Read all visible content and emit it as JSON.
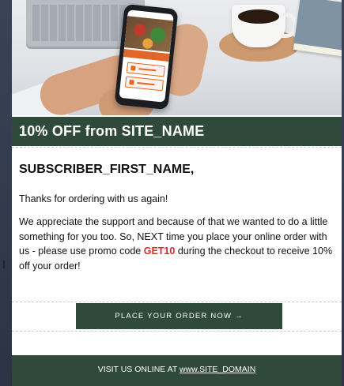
{
  "title_band": {
    "title": "10% OFF from SITE_NAME"
  },
  "body": {
    "greeting": "SUBSCRIBER_FIRST_NAME,",
    "thanks": "Thanks for ordering with us again!",
    "message_before_code": "We appreciate the support and because of that we wanted to do a little something for you too. So, NEXT time you place your online order with us - please use promo code ",
    "promo_code": "GET10",
    "message_after_code": " during the checkout to receive 10% off your order!"
  },
  "cta": {
    "label": "PLACE YOUR ORDER NOW →"
  },
  "footer": {
    "prefix": "VISIT US ONLINE AT ",
    "link_text": "www.SITE_DOMAIN"
  },
  "colors": {
    "accent_green": "#2f4a3a",
    "promo_red": "#e0262b",
    "background": "#2c3345"
  }
}
